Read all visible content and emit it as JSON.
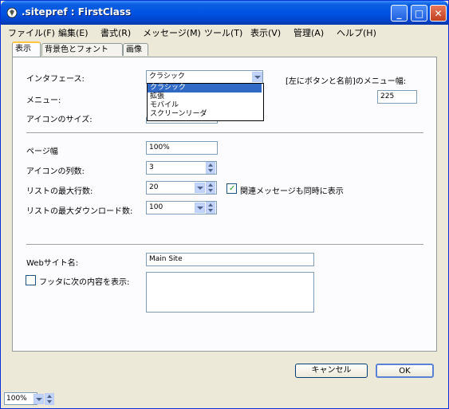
{
  "window": {
    "title": ".sitepref : FirstClass"
  },
  "menu": [
    "ファイル(F)",
    "編集(E)",
    "書式(R)",
    "メッセージ(M)",
    "ツール(T)",
    "表示(V)",
    "管理(A)",
    "ヘルプ(H)"
  ],
  "tabs": [
    "表示",
    "背景色とフォント",
    "画像"
  ],
  "form": {
    "interface_label": "インタフェース:",
    "interface_value": "クラシック",
    "interface_options": [
      "クラシック",
      "拡張",
      "モバイル",
      "スクリーンリーダ"
    ],
    "menu_label": "メニュー:",
    "icon_size_label": "アイコンのサイズ:",
    "left_menu_label": "[左にボタンと名前]のメニュー幅:",
    "left_menu_value": "225",
    "page_width_label": "ページ幅",
    "page_width_value": "100%",
    "icon_columns_label": "アイコンの列数:",
    "icon_columns_value": "3",
    "list_max_rows_label": "リストの最大行数:",
    "list_max_rows_value": "20",
    "related_msgs_label": "関連メッセージも同時に表示",
    "list_max_download_label": "リストの最大ダウンロード数:",
    "list_max_download_value": "100",
    "site_name_label": "Webサイト名:",
    "site_name_value": "Main Site",
    "footer_label": "フッタに次の内容を表示:"
  },
  "buttons": {
    "cancel": "キャンセル",
    "ok": "OK"
  },
  "status": {
    "zoom": "100%"
  }
}
